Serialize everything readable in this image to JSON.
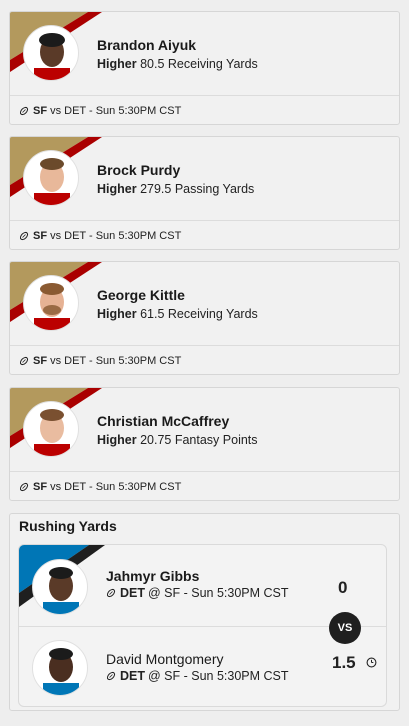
{
  "picks": [
    {
      "player": "Brandon Aiyuk",
      "direction": "Higher",
      "line": "80.5",
      "stat": "Receiving Yards",
      "team": "SF",
      "matchup": "vs DET - Sun 5:30PM CST"
    },
    {
      "player": "Brock Purdy",
      "direction": "Higher",
      "line": "279.5",
      "stat": "Passing Yards",
      "team": "SF",
      "matchup": "vs DET - Sun 5:30PM CST"
    },
    {
      "player": "George Kittle",
      "direction": "Higher",
      "line": "61.5",
      "stat": "Receiving Yards",
      "team": "SF",
      "matchup": "vs DET - Sun 5:30PM CST"
    },
    {
      "player": "Christian McCaffrey",
      "direction": "Higher",
      "line": "20.75",
      "stat": "Fantasy Points",
      "team": "SF",
      "matchup": "vs DET - Sun 5:30PM CST"
    }
  ],
  "rushing": {
    "title": "Rushing Yards",
    "vs_label": "VS",
    "top": {
      "player": "Jahmyr Gibbs",
      "team": "DET",
      "matchup": "@ SF - Sun 5:30PM CST",
      "score": "0"
    },
    "bottom": {
      "player": "David Montgomery",
      "team": "DET",
      "matchup": "@ SF - Sun 5:30PM CST",
      "score": "1.5"
    }
  },
  "colors": {
    "sf_red": "#aa0000",
    "sf_gold": "#b3995d",
    "det_blue": "#0076b6",
    "det_black": "#1f1f1f"
  },
  "icons": [
    "football-icon",
    "clock-icon"
  ]
}
